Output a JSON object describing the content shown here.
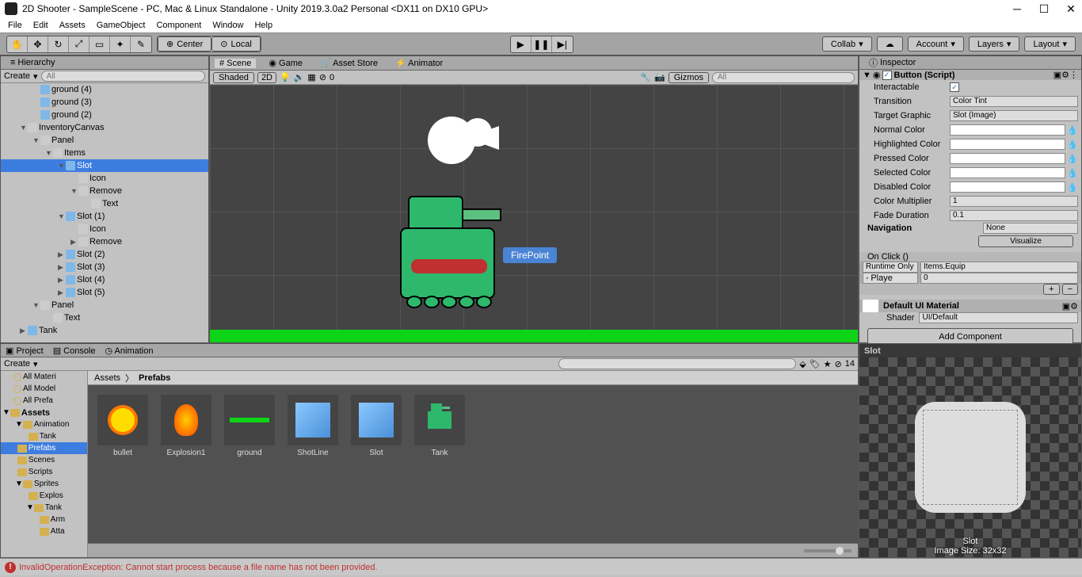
{
  "title": "2D Shooter - SampleScene - PC, Mac & Linux Standalone - Unity 2019.3.0a2 Personal <DX11 on DX10 GPU>",
  "menu": [
    "File",
    "Edit",
    "Assets",
    "GameObject",
    "Component",
    "Window",
    "Help"
  ],
  "toolbar": {
    "center": "Center",
    "local": "Local",
    "collab": "Collab",
    "account": "Account",
    "layers": "Layers",
    "layout": "Layout"
  },
  "hierarchy": {
    "title": "Hierarchy",
    "create": "Create",
    "search": "All",
    "nodes": [
      {
        "indent": 40,
        "label": "ground (4)",
        "icon": "cube",
        "fold": ""
      },
      {
        "indent": 40,
        "label": "ground (3)",
        "icon": "cube",
        "fold": ""
      },
      {
        "indent": 40,
        "label": "ground (2)",
        "icon": "cube",
        "fold": ""
      },
      {
        "indent": 24,
        "label": "InventoryCanvas",
        "icon": "go",
        "fold": "▼"
      },
      {
        "indent": 40,
        "label": "Panel",
        "icon": "go",
        "fold": "▼"
      },
      {
        "indent": 56,
        "label": "Items",
        "icon": "go",
        "fold": "▼"
      },
      {
        "indent": 72,
        "label": "Slot",
        "icon": "cube",
        "fold": "▼",
        "sel": true
      },
      {
        "indent": 88,
        "label": "Icon",
        "icon": "go",
        "fold": ""
      },
      {
        "indent": 88,
        "label": "Remove",
        "icon": "go",
        "fold": "▼"
      },
      {
        "indent": 104,
        "label": "Text",
        "icon": "go",
        "fold": ""
      },
      {
        "indent": 72,
        "label": "Slot (1)",
        "icon": "cube",
        "fold": "▼"
      },
      {
        "indent": 88,
        "label": "Icon",
        "icon": "go",
        "fold": ""
      },
      {
        "indent": 88,
        "label": "Remove",
        "icon": "go",
        "fold": "▶"
      },
      {
        "indent": 72,
        "label": "Slot (2)",
        "icon": "cube",
        "fold": "▶"
      },
      {
        "indent": 72,
        "label": "Slot (3)",
        "icon": "cube",
        "fold": "▶"
      },
      {
        "indent": 72,
        "label": "Slot (4)",
        "icon": "cube",
        "fold": "▶"
      },
      {
        "indent": 72,
        "label": "Slot (5)",
        "icon": "cube",
        "fold": "▶"
      },
      {
        "indent": 40,
        "label": "Panel",
        "icon": "go",
        "fold": "▼"
      },
      {
        "indent": 56,
        "label": "Text",
        "icon": "go",
        "fold": ""
      },
      {
        "indent": 24,
        "label": "Tank",
        "icon": "cube",
        "fold": "▶"
      }
    ]
  },
  "scene": {
    "tabs": [
      "Scene",
      "Game",
      "Asset Store",
      "Animator"
    ],
    "shaded": "Shaded",
    "mode": "2D",
    "gizmos": "Gizmos",
    "search": "All",
    "zero": "0",
    "firepoint": "FirePoint"
  },
  "inspector": {
    "title": "Inspector",
    "component": "Button (Script)",
    "rows": [
      {
        "label": "Interactable",
        "type": "check",
        "value": "✓"
      },
      {
        "label": "Transition",
        "type": "drop",
        "value": "Color Tint"
      },
      {
        "label": "Target Graphic",
        "type": "obj",
        "value": "Slot (Image)"
      },
      {
        "label": "Normal Color",
        "type": "color",
        "value": "#ffffff"
      },
      {
        "label": "Highlighted Color",
        "type": "color",
        "value": "#ffffff"
      },
      {
        "label": "Pressed Color",
        "type": "color",
        "value": "#ffffff"
      },
      {
        "label": "Selected Color",
        "type": "color",
        "value": "#ffffff"
      },
      {
        "label": "Disabled Color",
        "type": "color",
        "value": "#ffffff"
      },
      {
        "label": "Color Multiplier",
        "type": "field",
        "value": "1"
      },
      {
        "label": "Fade Duration",
        "type": "field",
        "value": "0.1"
      }
    ],
    "nav": "Navigation",
    "navval": "None",
    "visualize": "Visualize",
    "onclick": "On Click ()",
    "runtime": "Runtime Only",
    "method": "Items.Equip",
    "target": "Playe",
    "arg": "0",
    "material": "Default UI Material",
    "shaderlbl": "Shader",
    "shader": "UI/Default",
    "addcomp": "Add Component",
    "preview": "Slot",
    "previewsize": "Image Size: 32x32"
  },
  "project": {
    "tabs": [
      "Project",
      "Console",
      "Animation"
    ],
    "create": "Create",
    "count": "14",
    "favs": [
      "All Materi",
      "All Model",
      "All Prefa"
    ],
    "assetsLabel": "Assets",
    "folders": [
      {
        "label": "Animation",
        "fold": "▼",
        "indent": 6
      },
      {
        "label": "Tank",
        "fold": "",
        "indent": 20
      },
      {
        "label": "Prefabs",
        "fold": "",
        "indent": 6,
        "sel": true
      },
      {
        "label": "Scenes",
        "fold": "",
        "indent": 6
      },
      {
        "label": "Scripts",
        "fold": "",
        "indent": 6
      },
      {
        "label": "Sprites",
        "fold": "▼",
        "indent": 6
      },
      {
        "label": "Explos",
        "fold": "",
        "indent": 20
      },
      {
        "label": "Tank",
        "fold": "▼",
        "indent": 20
      },
      {
        "label": "Arm",
        "fold": "",
        "indent": 34
      },
      {
        "label": "Atta",
        "fold": "",
        "indent": 34
      }
    ],
    "breadcrumb": [
      "Assets",
      "Prefabs"
    ],
    "assets": [
      "bullet",
      "Explosion1",
      "ground",
      "ShotLine",
      "Slot",
      "Tank"
    ]
  },
  "error": "InvalidOperationException: Cannot start process because a file name has not been provided."
}
